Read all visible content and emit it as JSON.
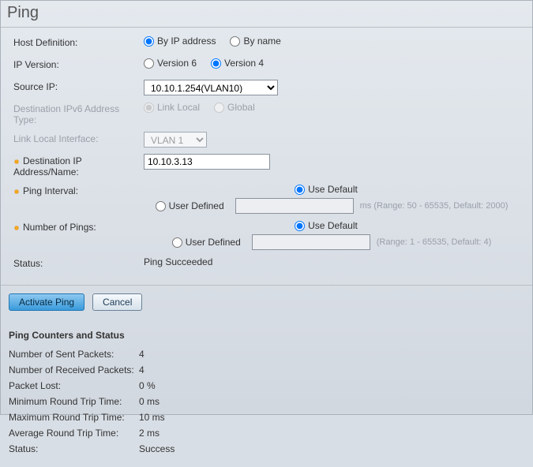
{
  "title": "Ping",
  "form": {
    "hostDef": {
      "label": "Host Definition:",
      "byIp": "By IP address",
      "byName": "By name",
      "selected": "byIp"
    },
    "ipVer": {
      "label": "IP Version:",
      "v6": "Version 6",
      "v4": "Version 4",
      "selected": "v4"
    },
    "source": {
      "label": "Source IP:",
      "value": "10.10.1.254(VLAN10)"
    },
    "destType": {
      "label": "Destination IPv6 Address Type:",
      "linkLocal": "Link Local",
      "global": "Global"
    },
    "linkLocal": {
      "label": "Link Local Interface:",
      "value": "VLAN 1"
    },
    "dest": {
      "label": "Destination IP Address/Name:",
      "value": "10.10.3.13"
    },
    "interval": {
      "label": "Ping Interval:",
      "useDefault": "Use Default",
      "userDefined": "User Defined",
      "hint": "ms (Range: 50 - 65535, Default: 2000)"
    },
    "numPings": {
      "label": "Number of Pings:",
      "useDefault": "Use Default",
      "userDefined": "User Defined",
      "hint": "(Range: 1 - 65535, Default: 4)"
    },
    "status": {
      "label": "Status:",
      "value": "Ping Succeeded"
    }
  },
  "buttons": {
    "activate": "Activate Ping",
    "cancel": "Cancel"
  },
  "counters": {
    "heading": "Ping Counters and Status",
    "sent": {
      "label": "Number of Sent Packets:",
      "value": "4"
    },
    "recv": {
      "label": "Number of Received Packets:",
      "value": "4"
    },
    "lost": {
      "label": "Packet Lost:",
      "value": "0 %"
    },
    "min": {
      "label": "Minimum Round Trip Time:",
      "value": "0 ms"
    },
    "max": {
      "label": "Maximum Round Trip Time:",
      "value": "10 ms"
    },
    "avg": {
      "label": "Average Round Trip Time:",
      "value": "2 ms"
    },
    "status": {
      "label": "Status:",
      "value": "Success"
    }
  }
}
